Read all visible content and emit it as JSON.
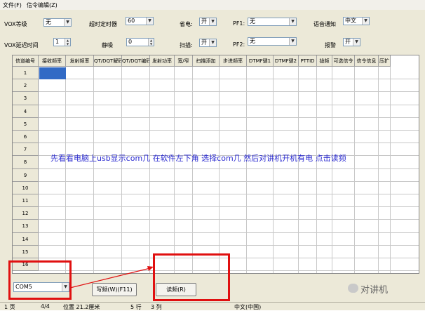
{
  "menu": {
    "file": "文件(F)",
    "signal_edit": "信令编辑(Z)"
  },
  "settings": {
    "vox_level": {
      "label": "VOX等级",
      "value": "无"
    },
    "timeout_timer": {
      "label": "超时定时器",
      "value": "60"
    },
    "power_save": {
      "label": "省电:",
      "value": "开"
    },
    "pf1": {
      "label": "PF1:",
      "value": "无"
    },
    "voice_prompt": {
      "label": "语音通知",
      "value": "中文"
    },
    "vox_delay": {
      "label": "VOX延迟时间",
      "value": "1"
    },
    "squelch": {
      "label": "静噪",
      "value": "0"
    },
    "scan": {
      "label": "扫描:",
      "value": "开"
    },
    "pf2": {
      "label": "PF2:",
      "value": "无"
    },
    "alarm": {
      "label": "报警",
      "value": "开"
    }
  },
  "table": {
    "columns": [
      "信道编号",
      "接收频率",
      "发射频率",
      "QT/DQT解码",
      "QT/DQT编码",
      "发射功率",
      "宽/窄",
      "扫描添加",
      "步进频率",
      "DTMF键1",
      "DTMF键2",
      "PTTID",
      "拢频",
      "可选信令",
      "信令信息",
      "压扩"
    ],
    "rows": [
      "1",
      "2",
      "3",
      "4",
      "5",
      "6",
      "7",
      "8",
      "9",
      "10",
      "11",
      "12",
      "13",
      "14",
      "15",
      "16"
    ]
  },
  "overlay_text": "先看看电脑上usb显示com几 在软件左下角 选择com几    然后对讲机开机有电 点击读频",
  "bottom": {
    "com_port": "COM5",
    "write_button": "写频(W)(F11)",
    "read_button": "读频(R)"
  },
  "status": {
    "s1": "1 页",
    "s2": "4/4",
    "s3": "位置 21.2厘米",
    "s4": "5 行",
    "s5": "3 列",
    "s6": "中文(中国)"
  },
  "watermark": "对讲机",
  "colors": {
    "selection": "#316ac5",
    "highlight_box": "#e01010",
    "hint_text": "#2b2bd0"
  }
}
